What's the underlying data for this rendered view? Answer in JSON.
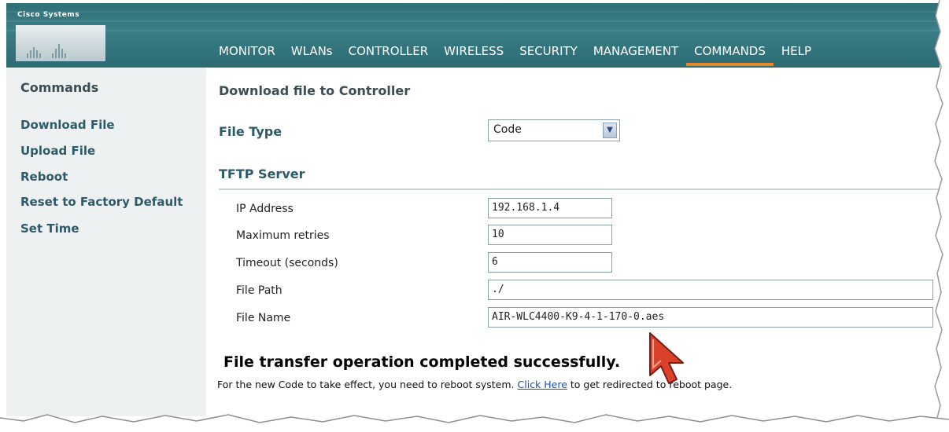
{
  "brand": {
    "logo_text": "Cisco Systems"
  },
  "nav": {
    "items": [
      "MONITOR",
      "WLANs",
      "CONTROLLER",
      "WIRELESS",
      "SECURITY",
      "MANAGEMENT",
      "COMMANDS",
      "HELP"
    ],
    "active": "COMMANDS",
    "active_color": "#e8862a"
  },
  "sidebar": {
    "title": "Commands",
    "items": [
      "Download File",
      "Upload File",
      "Reboot",
      "Reset to Factory Default",
      "Set Time"
    ]
  },
  "main": {
    "title": "Download file to Controller",
    "file_type_label": "File Type",
    "file_type_value": "Code",
    "tftp_title": "TFTP Server",
    "fields": [
      {
        "label": "IP Address",
        "value": "192.168.1.4"
      },
      {
        "label": "Maximum retries",
        "value": "10"
      },
      {
        "label": "Timeout (seconds)",
        "value": "6"
      },
      {
        "label": "File Path",
        "value": "./"
      },
      {
        "label": "File Name",
        "value": "AIR-WLC4400-K9-4-1-170-0.aes"
      }
    ],
    "success_message": "File transfer operation completed successfully.",
    "note_before": "For the new Code to take effect, you need to reboot system. ",
    "note_link": "Click Here",
    "note_after": " to get redirected to reboot page."
  },
  "icons": {
    "select_arrow": "chevron-down-icon",
    "cursor": "mouse-pointer-icon",
    "logo": "cisco-logo-icon"
  },
  "colors": {
    "header_bg": "#3a7e86",
    "sidebar_bg": "#edf1f2",
    "link": "#1a4fb5"
  }
}
